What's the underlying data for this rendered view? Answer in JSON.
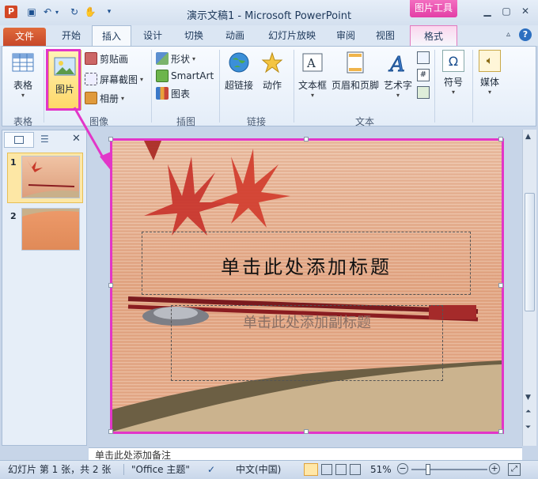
{
  "window": {
    "title": "演示文稿1 - Microsoft PowerPoint",
    "context_group": "图片工具"
  },
  "tabs": [
    {
      "label": "文件"
    },
    {
      "label": "开始"
    },
    {
      "label": "插入"
    },
    {
      "label": "设计"
    },
    {
      "label": "切换"
    },
    {
      "label": "动画"
    },
    {
      "label": "幻灯片放映"
    },
    {
      "label": "审阅"
    },
    {
      "label": "视图"
    },
    {
      "label": "格式"
    }
  ],
  "ribbon": {
    "groups": {
      "table": "表格",
      "image": "图像",
      "illustration": "插图",
      "link": "链接",
      "text": "文本"
    },
    "buttons": {
      "table": "表格",
      "picture": "图片",
      "clipart": "剪贴画",
      "screenshot": "屏幕截图",
      "album": "相册",
      "shapes": "形状",
      "smartart": "SmartArt",
      "chart": "图表",
      "hyperlink": "超链接",
      "action": "动作",
      "textbox": "文本框",
      "header_footer": "页眉和页脚",
      "wordart": "艺术字",
      "symbol": "符号",
      "media": "媒体"
    }
  },
  "slides": [
    {
      "number": "1"
    },
    {
      "number": "2"
    }
  ],
  "slide": {
    "title_placeholder": "单击此处添加标题",
    "subtitle_placeholder": "单击此处添加副标题"
  },
  "notes": {
    "text": "单击此处添加备注"
  },
  "status": {
    "slide_info": "幻灯片 第 1 张，共 2 张",
    "theme": "\"Office 主题\"",
    "language": "中文(中国)",
    "zoom": "51%"
  },
  "colors": {
    "accent_highlight": "#e236c8",
    "file_tab": "#d0532f",
    "context_tab": "#f063bd"
  }
}
